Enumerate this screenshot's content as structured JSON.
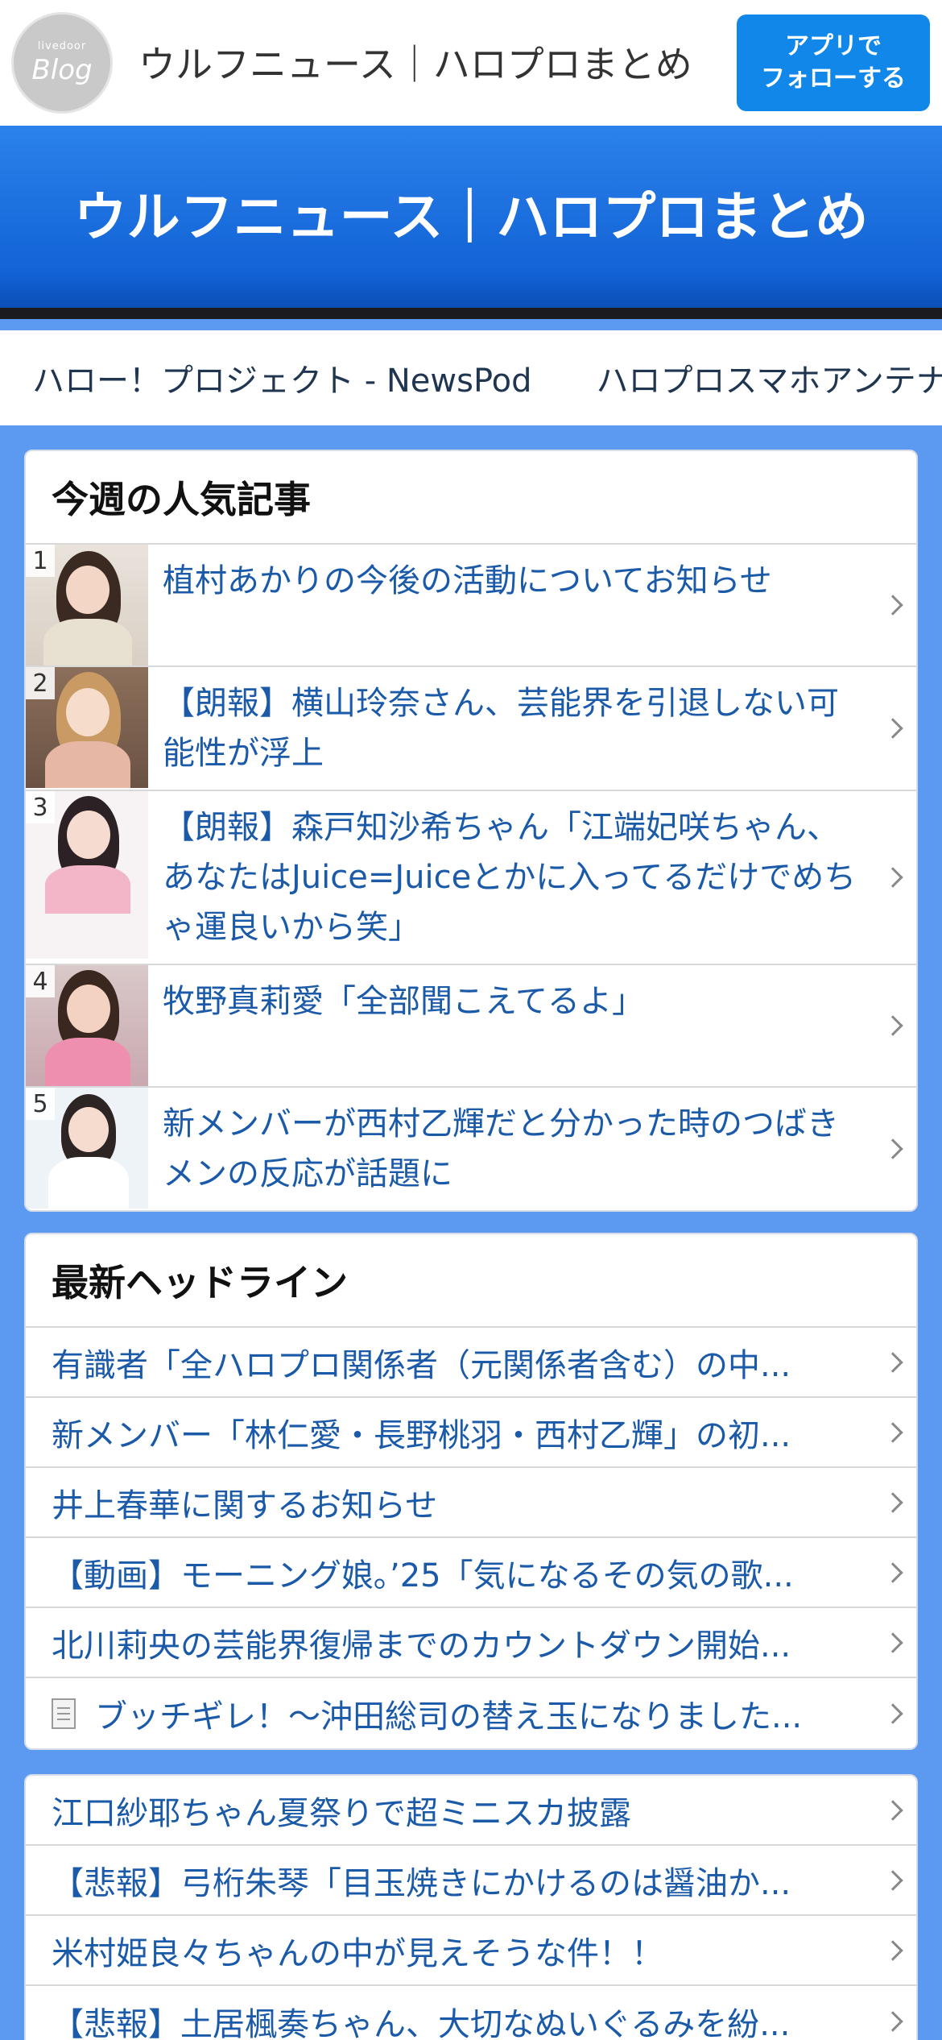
{
  "topbar": {
    "logo_small": "livedoor",
    "logo_big": "Blog",
    "site_title": "ウルフニュース｜ハロプロまとめ",
    "follow_line1": "アプリで",
    "follow_line2": "フォローする"
  },
  "banner": {
    "title": "ウルフニュース｜ハロプロまとめ"
  },
  "links": [
    "ハロー！プロジェクト - NewsPod",
    "ハロプロスマホアンテナ"
  ],
  "popular": {
    "title": "今週の人気記事",
    "items": [
      {
        "rank": "1",
        "title": "植村あかりの今後の活動についてお知らせ"
      },
      {
        "rank": "2",
        "title": "【朗報】横山玲奈さん、芸能界を引退しない可能性が浮上"
      },
      {
        "rank": "3",
        "title": "【朗報】森戸知沙希ちゃん「江端妃咲ちゃん、あなたはJuice=Juiceとかに入ってるだけでめちゃ運良いから笑」"
      },
      {
        "rank": "4",
        "title": "牧野真莉愛「全部聞こえてるよ」"
      },
      {
        "rank": "5",
        "title": "新メンバーが西村乙輝だと分かった時のつばきメンの反応が話題に"
      }
    ]
  },
  "headlines": {
    "title": "最新ヘッドライン",
    "items": [
      "有識者「全ハロプロ関係者（元関係者含む）の中...",
      "新メンバー「林仁愛・長野桃羽・西村乙輝」の初...",
      "井上春華に関するお知らせ",
      "【動画】モーニング娘｡’25「気になるその気の歌...",
      "北川莉央の芸能界復帰までのカウントダウン開始...",
      "ブッチギレ！～沖田総司の替え玉になりました..."
    ]
  },
  "more": {
    "items": [
      "江口紗耶ちゃん夏祭りで超ミニスカ披露",
      "【悲報】弓桁朱琴「目玉焼きにかけるのは醤油か...",
      "米村姫良々ちゃんの中が見えそうな件！！",
      "【悲報】土居楓奏ちゃん、大切なぬいぐるみを紛..."
    ]
  }
}
